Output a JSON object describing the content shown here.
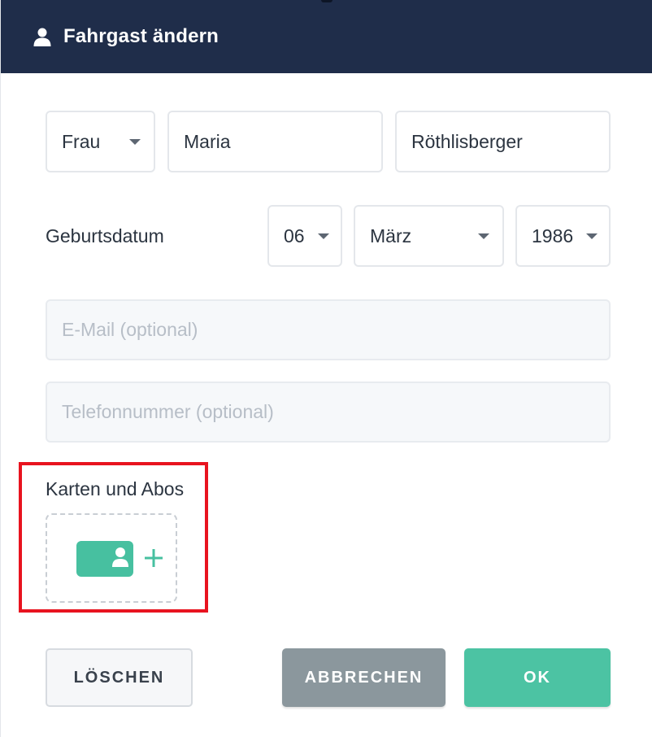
{
  "header": {
    "title": "Fahrgast ändern",
    "icon": "user-icon"
  },
  "form": {
    "salutation": {
      "selected": "Frau"
    },
    "first_name": {
      "value": "Maria"
    },
    "last_name": {
      "value": "Röthlisberger"
    },
    "birthdate": {
      "label": "Geburtsdatum",
      "day": "06",
      "month": "März",
      "year": "1986"
    },
    "email": {
      "placeholder": "E-Mail (optional)",
      "value": ""
    },
    "phone": {
      "placeholder": "Telefonnummer (optional)",
      "value": ""
    }
  },
  "cards": {
    "label": "Karten und Abos",
    "add_icon": "add-card-icon"
  },
  "buttons": {
    "delete": "LÖSCHEN",
    "cancel": "ABBRECHEN",
    "ok": "OK"
  },
  "colors": {
    "header_bg": "#1f2d4a",
    "accent": "#4cc3a3",
    "cancel_bg": "#8b979d",
    "highlight": "#e8131f"
  }
}
